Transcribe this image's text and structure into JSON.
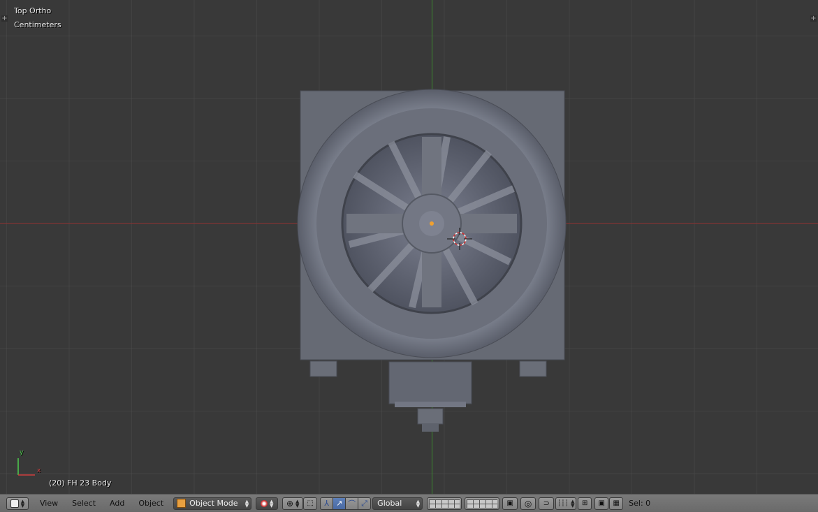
{
  "viewport": {
    "view_name": "Top Ortho",
    "unit_label": "Centimeters",
    "object_info": "(20) FH 23 Body",
    "axis_widget": {
      "y_label": "y",
      "x_label": "x"
    }
  },
  "header": {
    "editor_type_icon": "3d-view-icon",
    "menus": [
      "View",
      "Select",
      "Add",
      "Object"
    ],
    "mode_label": "Object Mode",
    "orientation_label": "Global",
    "selection_status": "Sel: 0"
  },
  "colors": {
    "background": "#393939",
    "x_axis": "#8a2e2e",
    "y_axis": "#3b8a2e",
    "header": "#727272",
    "active_button": "#5d7fb8",
    "model": "#6e7280"
  }
}
